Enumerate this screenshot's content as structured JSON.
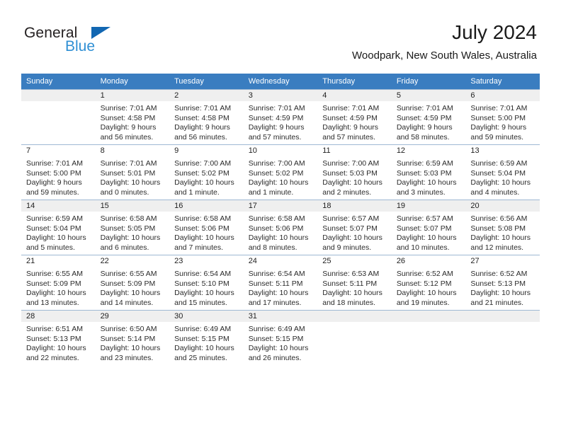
{
  "brand": {
    "name_part1": "General",
    "name_part2": "Blue",
    "triangle_color": "#1267b2",
    "blue_text_color": "#2f8fd4"
  },
  "header": {
    "title": "July 2024",
    "subtitle": "Woodpark, New South Wales, Australia"
  },
  "theme": {
    "header_row_bg": "#3a7dc0",
    "header_row_text": "#ffffff",
    "shaded_row_bg": "#efefef",
    "grid_line": "#9fb9d4"
  },
  "weekday_headers": [
    "Sunday",
    "Monday",
    "Tuesday",
    "Wednesday",
    "Thursday",
    "Friday",
    "Saturday"
  ],
  "weeks": [
    {
      "shaded": true,
      "days": [
        {
          "num": "",
          "empty": true,
          "sunrise": "",
          "sunset": "",
          "daylight1": "",
          "daylight2": ""
        },
        {
          "num": "1",
          "sunrise": "Sunrise: 7:01 AM",
          "sunset": "Sunset: 4:58 PM",
          "daylight1": "Daylight: 9 hours",
          "daylight2": "and 56 minutes."
        },
        {
          "num": "2",
          "sunrise": "Sunrise: 7:01 AM",
          "sunset": "Sunset: 4:58 PM",
          "daylight1": "Daylight: 9 hours",
          "daylight2": "and 56 minutes."
        },
        {
          "num": "3",
          "sunrise": "Sunrise: 7:01 AM",
          "sunset": "Sunset: 4:59 PM",
          "daylight1": "Daylight: 9 hours",
          "daylight2": "and 57 minutes."
        },
        {
          "num": "4",
          "sunrise": "Sunrise: 7:01 AM",
          "sunset": "Sunset: 4:59 PM",
          "daylight1": "Daylight: 9 hours",
          "daylight2": "and 57 minutes."
        },
        {
          "num": "5",
          "sunrise": "Sunrise: 7:01 AM",
          "sunset": "Sunset: 4:59 PM",
          "daylight1": "Daylight: 9 hours",
          "daylight2": "and 58 minutes."
        },
        {
          "num": "6",
          "sunrise": "Sunrise: 7:01 AM",
          "sunset": "Sunset: 5:00 PM",
          "daylight1": "Daylight: 9 hours",
          "daylight2": "and 59 minutes."
        }
      ]
    },
    {
      "shaded": false,
      "days": [
        {
          "num": "7",
          "sunrise": "Sunrise: 7:01 AM",
          "sunset": "Sunset: 5:00 PM",
          "daylight1": "Daylight: 9 hours",
          "daylight2": "and 59 minutes."
        },
        {
          "num": "8",
          "sunrise": "Sunrise: 7:01 AM",
          "sunset": "Sunset: 5:01 PM",
          "daylight1": "Daylight: 10 hours",
          "daylight2": "and 0 minutes."
        },
        {
          "num": "9",
          "sunrise": "Sunrise: 7:00 AM",
          "sunset": "Sunset: 5:02 PM",
          "daylight1": "Daylight: 10 hours",
          "daylight2": "and 1 minute."
        },
        {
          "num": "10",
          "sunrise": "Sunrise: 7:00 AM",
          "sunset": "Sunset: 5:02 PM",
          "daylight1": "Daylight: 10 hours",
          "daylight2": "and 1 minute."
        },
        {
          "num": "11",
          "sunrise": "Sunrise: 7:00 AM",
          "sunset": "Sunset: 5:03 PM",
          "daylight1": "Daylight: 10 hours",
          "daylight2": "and 2 minutes."
        },
        {
          "num": "12",
          "sunrise": "Sunrise: 6:59 AM",
          "sunset": "Sunset: 5:03 PM",
          "daylight1": "Daylight: 10 hours",
          "daylight2": "and 3 minutes."
        },
        {
          "num": "13",
          "sunrise": "Sunrise: 6:59 AM",
          "sunset": "Sunset: 5:04 PM",
          "daylight1": "Daylight: 10 hours",
          "daylight2": "and 4 minutes."
        }
      ]
    },
    {
      "shaded": true,
      "days": [
        {
          "num": "14",
          "sunrise": "Sunrise: 6:59 AM",
          "sunset": "Sunset: 5:04 PM",
          "daylight1": "Daylight: 10 hours",
          "daylight2": "and 5 minutes."
        },
        {
          "num": "15",
          "sunrise": "Sunrise: 6:58 AM",
          "sunset": "Sunset: 5:05 PM",
          "daylight1": "Daylight: 10 hours",
          "daylight2": "and 6 minutes."
        },
        {
          "num": "16",
          "sunrise": "Sunrise: 6:58 AM",
          "sunset": "Sunset: 5:06 PM",
          "daylight1": "Daylight: 10 hours",
          "daylight2": "and 7 minutes."
        },
        {
          "num": "17",
          "sunrise": "Sunrise: 6:58 AM",
          "sunset": "Sunset: 5:06 PM",
          "daylight1": "Daylight: 10 hours",
          "daylight2": "and 8 minutes."
        },
        {
          "num": "18",
          "sunrise": "Sunrise: 6:57 AM",
          "sunset": "Sunset: 5:07 PM",
          "daylight1": "Daylight: 10 hours",
          "daylight2": "and 9 minutes."
        },
        {
          "num": "19",
          "sunrise": "Sunrise: 6:57 AM",
          "sunset": "Sunset: 5:07 PM",
          "daylight1": "Daylight: 10 hours",
          "daylight2": "and 10 minutes."
        },
        {
          "num": "20",
          "sunrise": "Sunrise: 6:56 AM",
          "sunset": "Sunset: 5:08 PM",
          "daylight1": "Daylight: 10 hours",
          "daylight2": "and 12 minutes."
        }
      ]
    },
    {
      "shaded": false,
      "days": [
        {
          "num": "21",
          "sunrise": "Sunrise: 6:55 AM",
          "sunset": "Sunset: 5:09 PM",
          "daylight1": "Daylight: 10 hours",
          "daylight2": "and 13 minutes."
        },
        {
          "num": "22",
          "sunrise": "Sunrise: 6:55 AM",
          "sunset": "Sunset: 5:09 PM",
          "daylight1": "Daylight: 10 hours",
          "daylight2": "and 14 minutes."
        },
        {
          "num": "23",
          "sunrise": "Sunrise: 6:54 AM",
          "sunset": "Sunset: 5:10 PM",
          "daylight1": "Daylight: 10 hours",
          "daylight2": "and 15 minutes."
        },
        {
          "num": "24",
          "sunrise": "Sunrise: 6:54 AM",
          "sunset": "Sunset: 5:11 PM",
          "daylight1": "Daylight: 10 hours",
          "daylight2": "and 17 minutes."
        },
        {
          "num": "25",
          "sunrise": "Sunrise: 6:53 AM",
          "sunset": "Sunset: 5:11 PM",
          "daylight1": "Daylight: 10 hours",
          "daylight2": "and 18 minutes."
        },
        {
          "num": "26",
          "sunrise": "Sunrise: 6:52 AM",
          "sunset": "Sunset: 5:12 PM",
          "daylight1": "Daylight: 10 hours",
          "daylight2": "and 19 minutes."
        },
        {
          "num": "27",
          "sunrise": "Sunrise: 6:52 AM",
          "sunset": "Sunset: 5:13 PM",
          "daylight1": "Daylight: 10 hours",
          "daylight2": "and 21 minutes."
        }
      ]
    },
    {
      "shaded": true,
      "days": [
        {
          "num": "28",
          "sunrise": "Sunrise: 6:51 AM",
          "sunset": "Sunset: 5:13 PM",
          "daylight1": "Daylight: 10 hours",
          "daylight2": "and 22 minutes."
        },
        {
          "num": "29",
          "sunrise": "Sunrise: 6:50 AM",
          "sunset": "Sunset: 5:14 PM",
          "daylight1": "Daylight: 10 hours",
          "daylight2": "and 23 minutes."
        },
        {
          "num": "30",
          "sunrise": "Sunrise: 6:49 AM",
          "sunset": "Sunset: 5:15 PM",
          "daylight1": "Daylight: 10 hours",
          "daylight2": "and 25 minutes."
        },
        {
          "num": "31",
          "sunrise": "Sunrise: 6:49 AM",
          "sunset": "Sunset: 5:15 PM",
          "daylight1": "Daylight: 10 hours",
          "daylight2": "and 26 minutes."
        },
        {
          "num": "",
          "empty": true,
          "sunrise": "",
          "sunset": "",
          "daylight1": "",
          "daylight2": ""
        },
        {
          "num": "",
          "empty": true,
          "sunrise": "",
          "sunset": "",
          "daylight1": "",
          "daylight2": ""
        },
        {
          "num": "",
          "empty": true,
          "sunrise": "",
          "sunset": "",
          "daylight1": "",
          "daylight2": ""
        }
      ]
    }
  ]
}
